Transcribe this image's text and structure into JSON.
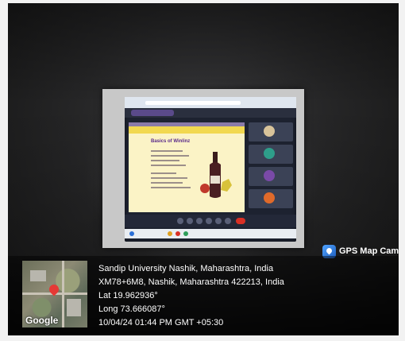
{
  "overlay": {
    "badge_label": "GPS Map Camera",
    "badge_icon": "gps-map-camera-icon",
    "address_line": "Sandip University Nashik, Maharashtra, India",
    "plus_code_line": "XM78+6M8, Nashik, Maharashtra 422213, India",
    "latitude": "Lat 19.962936°",
    "longitude": "Long 73.666087°",
    "timestamp": "10/04/24 01:44 PM GMT +05:30",
    "map_logo": "Google"
  },
  "slide": {
    "heading": "Basics of Winlinz"
  },
  "colors": {
    "slide_background": "#fbf3c6",
    "slide_band": "#f2d84f",
    "gps_badge": "#1f5fbf"
  }
}
